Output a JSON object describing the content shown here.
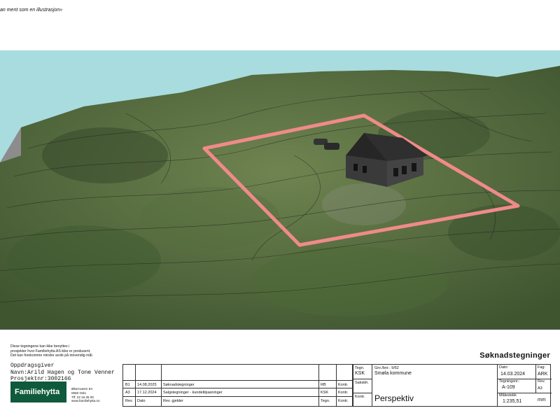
{
  "top_note": "an ment som en illustrasjon»",
  "disclaimer": {
    "line1": "Disse tegningene kan ikke benyttes i",
    "line2": "prosjekter hvor Familiehytta AS ikke er produsent.",
    "line3": "Det kan forekomme mindre avvik på innvendig mål."
  },
  "client": {
    "line1": "Oppdragsgiver",
    "line2": "Navn:Arild Hagen og Tone Venner",
    "line3": "Prosjektnr:3002166"
  },
  "logo_text": "Familiehytta",
  "address": {
    "street": "Økernveien 94",
    "city": "0650 Oslo",
    "phone": "Tlf: 22 16 35 00",
    "web": "www.familiehytta.no"
  },
  "heading": "Søknadstegninger",
  "revisions": {
    "headers": {
      "rev": "Rev.",
      "date": "Dato",
      "desc": "Rev. gjelder",
      "drawn": "Tegn.",
      "ctrl": "Kontr."
    },
    "rows": [
      {
        "rev": "B1",
        "date": "14.08.2025",
        "desc": "Søknadstegninger",
        "drawn": "RB",
        "ctrl": "Kontr."
      },
      {
        "rev": "A3",
        "date": "17.12.2024",
        "desc": "Salgstegninger - kundetilpasninger",
        "drawn": "KSK",
        "ctrl": "Kontr."
      }
    ]
  },
  "titleblock": {
    "tegn_label": "Tegn.",
    "tegn_value": "KSK",
    "saksbh_label": "Saksbh.",
    "kontr_label": "Kontr.",
    "gnr_label": "Gnr./bnr.: 9/62",
    "municipality": "Smøla kommune",
    "drawing_title": "Perspektiv",
    "dato_label": "Dato:",
    "dato_value": "14.03.2024",
    "fag_label": "Fag:",
    "fag_value": "ARK",
    "tegningsnr_label": "Tegningsnr.:",
    "tegningsnr_value": "A-109",
    "rev_label": "Rev.",
    "format_value": "A3",
    "malestokk_label": "Målestokk",
    "malestokk_value": "1:235,51",
    "unit": "mm"
  },
  "colors": {
    "sky": "#a9dcde",
    "terrain": "#5d7342",
    "plot_boundary": "#f08a8a",
    "cabin": "#2f2f2f",
    "logo_bg": "#0f5a3c"
  }
}
